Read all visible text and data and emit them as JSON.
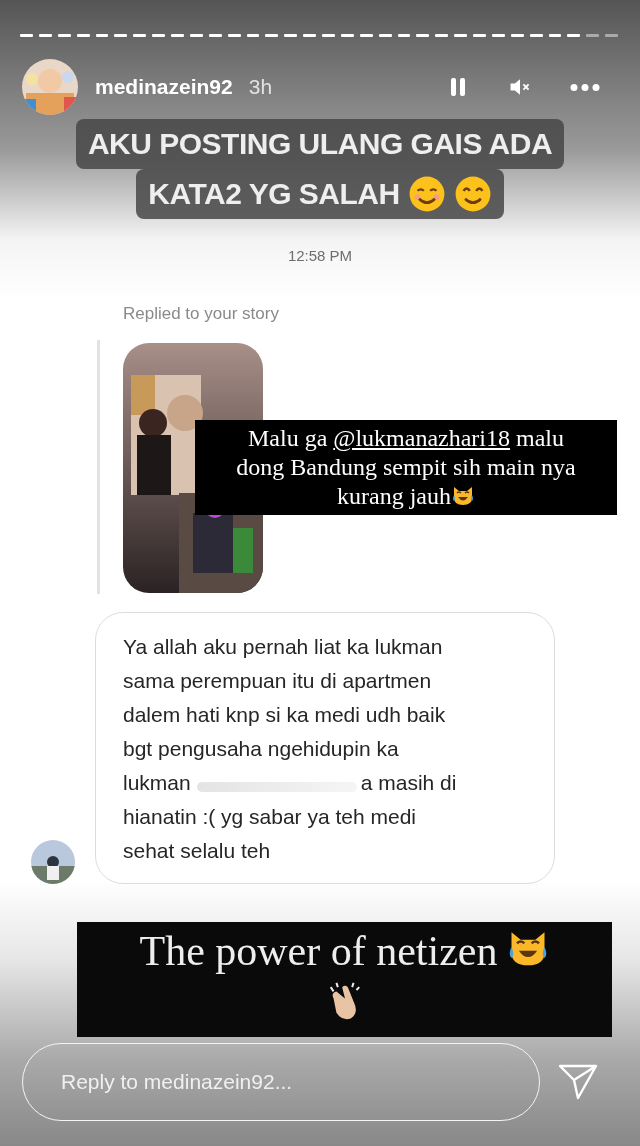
{
  "progress": {
    "level": 0.93
  },
  "header": {
    "username": "medinazein92",
    "time": "3h",
    "paused": false,
    "muted": true
  },
  "caption": [
    "AKU POSTING ULANG GAIS ADA",
    "KATA2 YG SALAH"
  ],
  "message_time": "12:58 PM",
  "reply_label": "Replied to your story",
  "story_caption": {
    "before": "Malu ga ",
    "mention": "@lukmanazhari18",
    "after": " malu dong Bandung sempit sih main nya kurang jauh"
  },
  "message_lines": [
    [
      "Ya allah aku pernah liat ka lukman"
    ],
    [
      "sama perempuan itu di apartmen"
    ],
    [
      "dalem hati knp si ka medi udh baik"
    ],
    [
      "bgt pengusaha ngehidupin ka"
    ],
    [
      "lukman",
      "a masih di"
    ],
    [
      "hianatin :( yg sabar ya teh medi"
    ],
    [
      "sehat selalu teh"
    ]
  ],
  "bottom_caption": "The power of netizen",
  "reply_field": {
    "placeholder": "Reply to medinazein92..."
  }
}
